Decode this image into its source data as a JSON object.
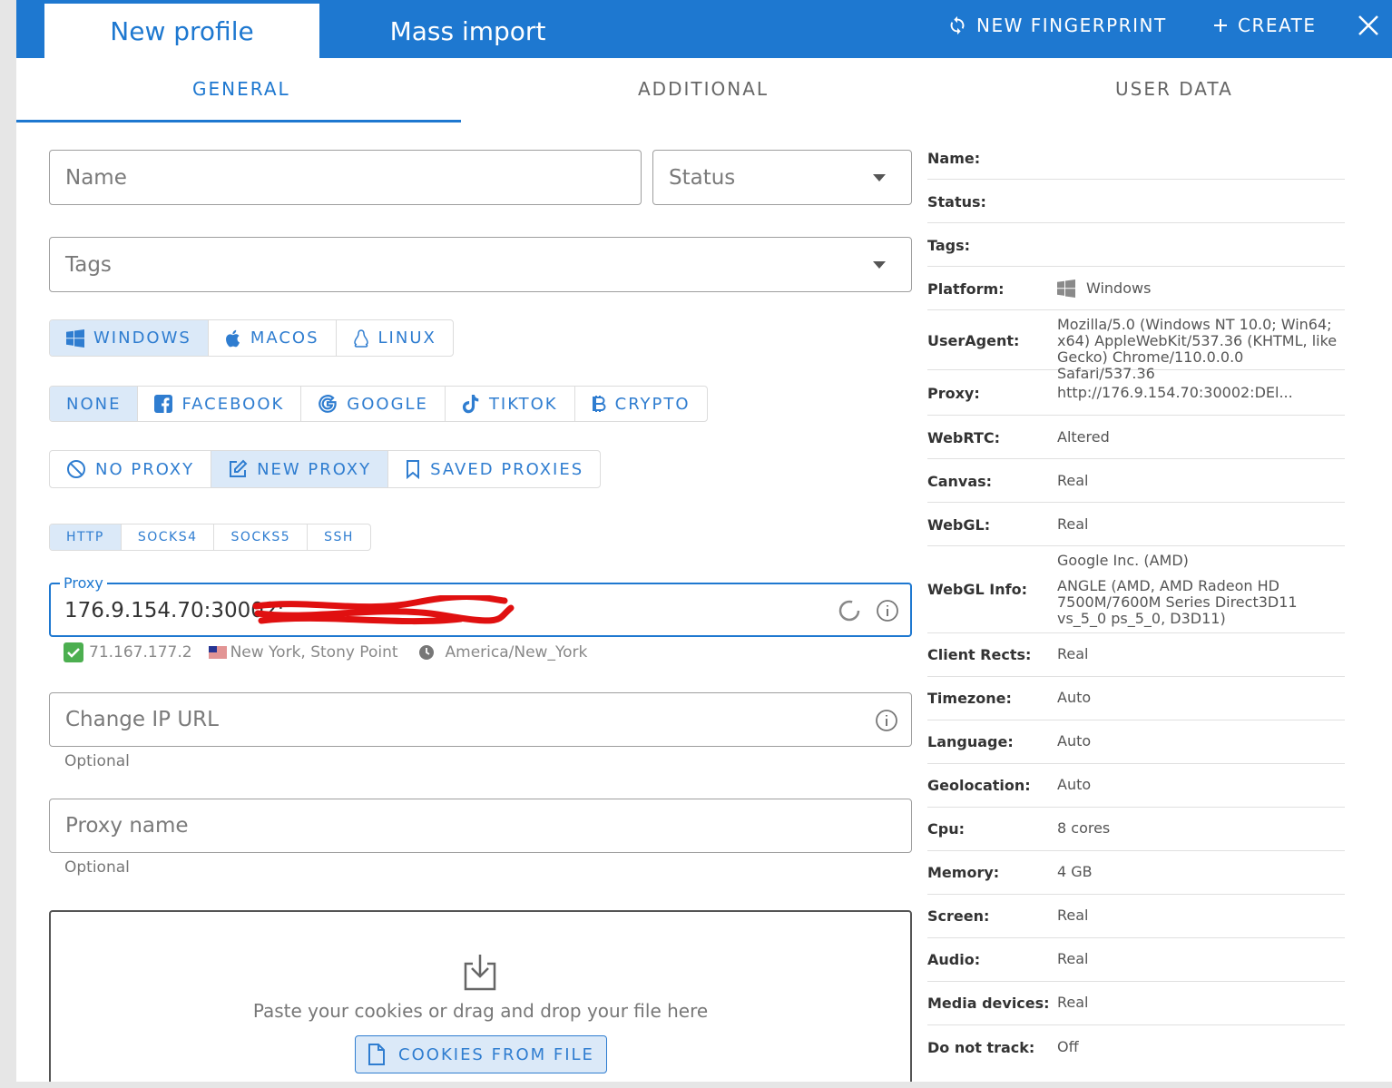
{
  "top_tabs": {
    "active": "New profile",
    "inactive": "Mass import"
  },
  "top_actions": {
    "fingerprint": "NEW FINGERPRINT",
    "create": "CREATE"
  },
  "section_tabs": [
    "GENERAL",
    "ADDITIONAL",
    "USER DATA"
  ],
  "form": {
    "name_placeholder": "Name",
    "status_placeholder": "Status",
    "tags_placeholder": "Tags",
    "os": [
      "WINDOWS",
      "MACOS",
      "LINUX"
    ],
    "platforms": [
      "NONE",
      "FACEBOOK",
      "GOOGLE",
      "TIKTOK",
      "CRYPTO"
    ],
    "proxy_modes": [
      "NO PROXY",
      "NEW PROXY",
      "SAVED PROXIES"
    ],
    "proxy_types": [
      "HTTP",
      "SOCKS4",
      "SOCKS5",
      "SSH"
    ],
    "proxy_label": "Proxy",
    "proxy_value": "176.9.154.70:30002:",
    "proxy_ip": "71.167.177.2",
    "proxy_location": "New York, Stony Point",
    "proxy_timezone": "America/New_York",
    "change_ip_placeholder": "Change IP URL",
    "change_ip_hint": "Optional",
    "proxy_name_placeholder": "Proxy name",
    "proxy_name_hint": "Optional",
    "drop_text": "Paste your cookies or drag and drop your file here",
    "cookies_button": "COOKIES FROM FILE"
  },
  "summary": {
    "name": "Name:",
    "status": "Status:",
    "tags": "Tags:",
    "platform_key": "Platform:",
    "platform_val": "Windows",
    "ua_key": "UserAgent:",
    "ua_val": "Mozilla/5.0 (Windows NT 10.0; Win64; x64) AppleWebKit/537.36 (KHTML, like Gecko) Chrome/110.0.0.0 Safari/537.36",
    "proxy_key": "Proxy:",
    "proxy_val": "http://176.9.154.70:30002:DEl...",
    "webrtc_key": "WebRTC:",
    "webrtc_val": "Altered",
    "canvas_key": "Canvas:",
    "canvas_val": "Real",
    "webgl_key": "WebGL:",
    "webgl_val": "Real",
    "webglinfo_key": "WebGL Info:",
    "webglinfo_vendor": "Google Inc. (AMD)",
    "webglinfo_renderer": "ANGLE (AMD, AMD Radeon HD 7500M/7600M Series Direct3D11 vs_5_0 ps_5_0, D3D11)",
    "rects_key": "Client Rects:",
    "rects_val": "Real",
    "tz_key": "Timezone:",
    "tz_val": "Auto",
    "lang_key": "Language:",
    "lang_val": "Auto",
    "geo_key": "Geolocation:",
    "geo_val": "Auto",
    "cpu_key": "Cpu:",
    "cpu_val": "8 cores",
    "mem_key": "Memory:",
    "mem_val": "4 GB",
    "screen_key": "Screen:",
    "screen_val": "Real",
    "audio_key": "Audio:",
    "audio_val": "Real",
    "media_key": "Media devices:",
    "media_val": "Real",
    "dnt_key": "Do not track:",
    "dnt_val": "Off"
  },
  "colors": {
    "primary": "#1e78d0",
    "selected_bg": "#dbe9f8",
    "check_green": "#4caf50"
  }
}
